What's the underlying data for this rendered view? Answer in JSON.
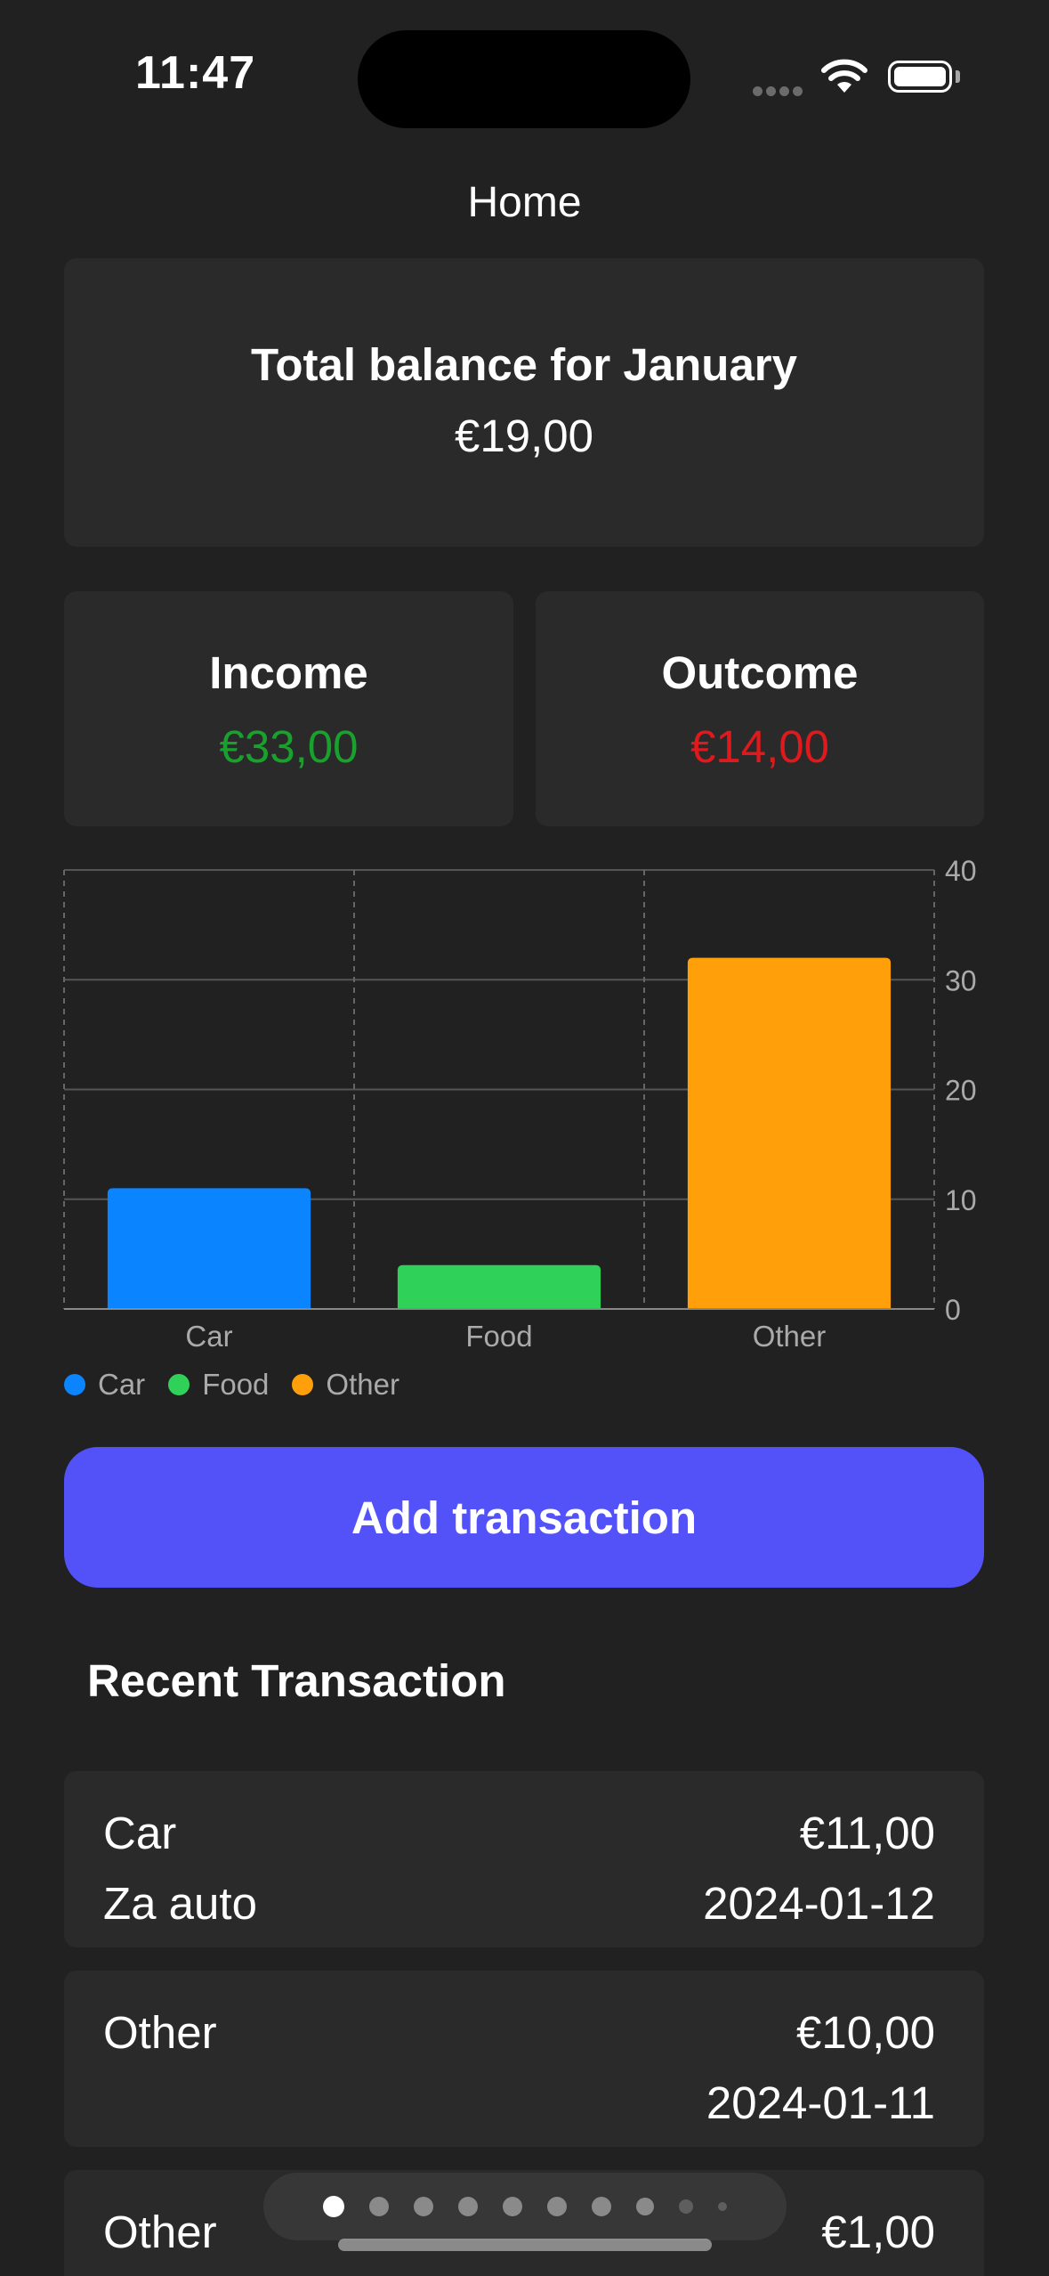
{
  "status_bar": {
    "time": "11:47"
  },
  "nav": {
    "title": "Home"
  },
  "balance": {
    "title": "Total balance for January",
    "value": "€19,00"
  },
  "income": {
    "label": "Income",
    "value": "€33,00",
    "color": "#18a22d"
  },
  "outcome": {
    "label": "Outcome",
    "value": "€14,00",
    "color": "#e0191d"
  },
  "chart_data": {
    "type": "bar",
    "categories": [
      "Car",
      "Food",
      "Other"
    ],
    "values": [
      11,
      4,
      32
    ],
    "colors": [
      "#0a84ff",
      "#30d158",
      "#ff9f0a"
    ],
    "ylim": [
      0,
      40
    ],
    "yticks": [
      0,
      10,
      20,
      30,
      40
    ],
    "y_axis_side": "right",
    "grid": true,
    "legend": {
      "placement": "bottom-left",
      "entries": [
        "Car",
        "Food",
        "Other"
      ]
    }
  },
  "actions": {
    "add_transaction": "Add transaction"
  },
  "recent": {
    "title": "Recent Transaction",
    "items": [
      {
        "category": "Car",
        "note": "Za auto",
        "amount": "€11,00",
        "date": "2024-01-12"
      },
      {
        "category": "Other",
        "note": "",
        "amount": "€10,00",
        "date": "2024-01-11"
      },
      {
        "category": "Other",
        "note": "",
        "amount": "€1,00",
        "date": ""
      }
    ]
  },
  "pager": {
    "pages": 10,
    "current": 0
  }
}
